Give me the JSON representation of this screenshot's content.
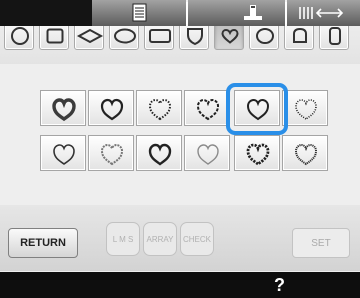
{
  "shape_tabs": [
    {
      "icon": "circle-icon",
      "selected": false
    },
    {
      "icon": "square-icon",
      "selected": false
    },
    {
      "icon": "diamond-icon",
      "selected": false
    },
    {
      "icon": "ellipse-icon",
      "selected": false
    },
    {
      "icon": "rectangle-icon",
      "selected": false
    },
    {
      "icon": "shield-icon",
      "selected": false
    },
    {
      "icon": "heart-icon",
      "selected": true
    },
    {
      "icon": "oval-icon",
      "selected": false
    },
    {
      "icon": "arch-icon",
      "selected": false
    },
    {
      "icon": "tall-rounded-rectangle-icon",
      "selected": false
    }
  ],
  "stitch_tiles": [
    {
      "icon": "heart-outline-bold-icon",
      "selected": false
    },
    {
      "icon": "heart-outline-thick-icon",
      "selected": false
    },
    {
      "icon": "heart-dotted-icon",
      "selected": false
    },
    {
      "icon": "heart-dashed-icon",
      "selected": false
    },
    {
      "icon": "heart-zigzag-icon",
      "selected": true
    },
    {
      "icon": "heart-fine-dotted-icon",
      "selected": false
    },
    {
      "icon": "heart-stitched-icon",
      "selected": false
    },
    {
      "icon": "heart-scalloped-icon",
      "selected": false
    },
    {
      "icon": "heart-looped-icon",
      "selected": false
    },
    {
      "icon": "heart-thin-outline-icon",
      "selected": false
    },
    {
      "icon": "heart-beaded-icon",
      "selected": false
    },
    {
      "icon": "heart-wavy-icon",
      "selected": false
    }
  ],
  "actions": {
    "return_label": "RETURN",
    "lms_label": "L M S",
    "array_label": "ARRAY",
    "check_label": "CHECK",
    "set_label": "SET"
  },
  "status_bar": {
    "help_mark": "?"
  },
  "colors": {
    "accent": "#2a8fe8",
    "bottom_bar": "#0e0e0e"
  }
}
